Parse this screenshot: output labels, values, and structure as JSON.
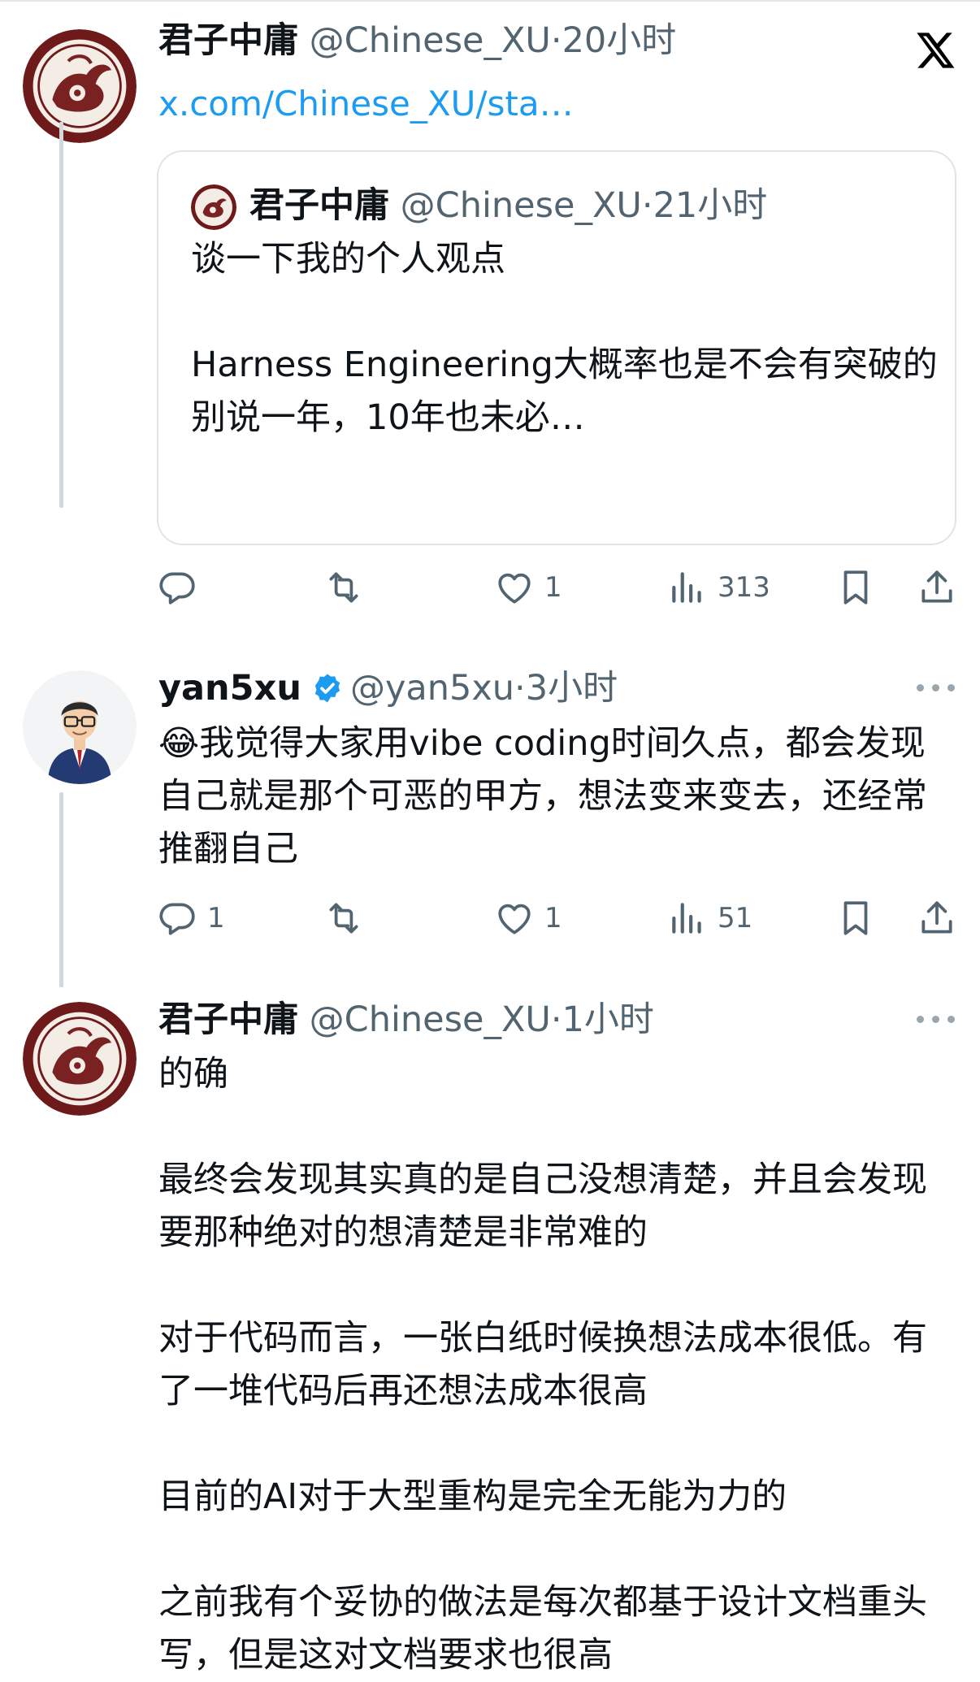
{
  "tweets": [
    {
      "name": "君子中庸",
      "handle": "@Chinese_XU",
      "time": "20小时",
      "link": "x.com/Chinese_XU/sta…",
      "quote": {
        "name": "君子中庸",
        "handle": "@Chinese_XU",
        "time": "21小时",
        "text": "谈一下我的个人观点\n\nHarness Engineering大概率也是不会有突破的\n别说一年，10年也未必…"
      },
      "metrics": {
        "replies": "",
        "retweets": "",
        "likes": "1",
        "views": "313"
      }
    },
    {
      "name": "yan5xu",
      "handle": "@yan5xu",
      "time": "3小时",
      "verified": true,
      "emoji": "😂",
      "text": "我觉得大家用vibe coding时间久点，都会发现自己就是那个可恶的甲方，想法变来变去，还经常推翻自己",
      "metrics": {
        "replies": "1",
        "retweets": "",
        "likes": "1",
        "views": "51"
      }
    },
    {
      "name": "君子中庸",
      "handle": "@Chinese_XU",
      "time": "1小时",
      "text": "的确\n\n最终会发现其实真的是自己没想清楚，并且会发现要那种绝对的想清楚是非常难的\n\n对于代码而言，一张白纸时候换想法成本很低。有了一堆代码后再还想法成本很高\n\n目前的AI对于大型重构是完全无能为力的\n\n之前我有个妥协的做法是每次都基于设计文档重头写，但是这对文档要求也很高"
    }
  ],
  "separator": "·",
  "colors": {
    "accent": "#1d9bf0",
    "text": "#0f1419",
    "secondary": "#536471",
    "thread_line": "#cfd9de"
  },
  "icons": [
    "x-logo-icon",
    "reply-icon",
    "retweet-icon",
    "like-icon",
    "views-icon",
    "bookmark-icon",
    "share-icon",
    "more-icon",
    "verified-icon"
  ]
}
